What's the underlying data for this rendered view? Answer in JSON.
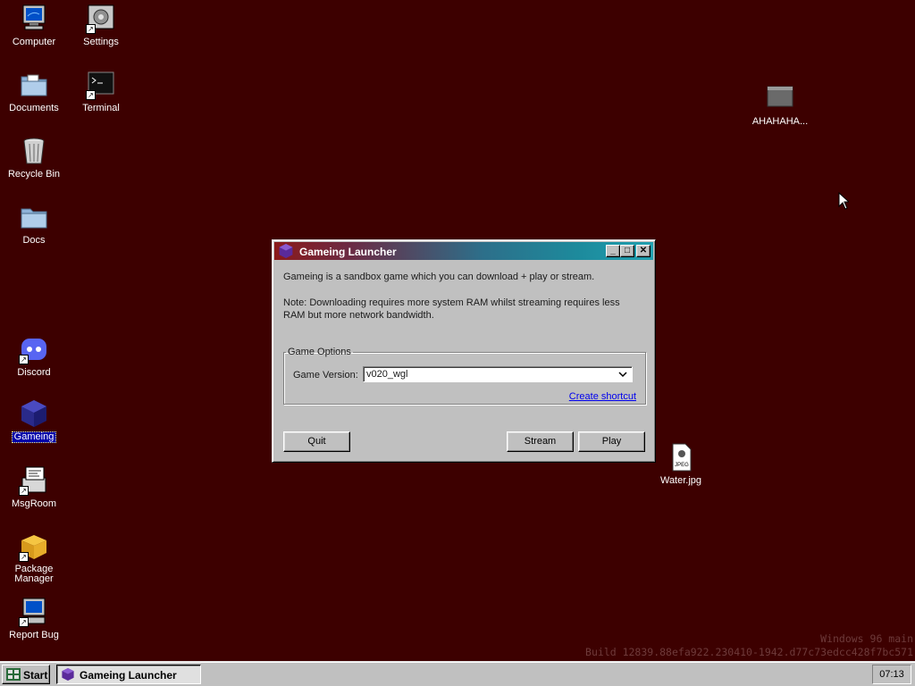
{
  "desktop": {
    "background": "#3d0000",
    "icons": {
      "computer": {
        "label": "Computer",
        "icon": "computer-icon"
      },
      "settings": {
        "label": "Settings",
        "icon": "settings-icon"
      },
      "documents": {
        "label": "Documents",
        "icon": "documents-folder-icon"
      },
      "terminal": {
        "label": "Terminal",
        "icon": "terminal-icon"
      },
      "recycle_bin": {
        "label": "Recycle Bin",
        "icon": "recycle-bin-icon"
      },
      "docs": {
        "label": "Docs",
        "icon": "folder-icon"
      },
      "discord": {
        "label": "Discord",
        "icon": "discord-icon"
      },
      "gameing": {
        "label": "Gameing",
        "icon": "gameing-cube-icon",
        "selected": true
      },
      "msgroom": {
        "label": "MsgRoom",
        "icon": "msgroom-icon"
      },
      "package_manager": {
        "label": "Package Manager",
        "icon": "package-icon"
      },
      "report_bug": {
        "label": "Report Bug",
        "icon": "report-bug-icon"
      },
      "ahahaha": {
        "label": "AHAHAHA...",
        "icon": "dark-folder-icon"
      },
      "water": {
        "label": "Water.jpg",
        "icon": "jpeg-file-icon"
      }
    },
    "watermark": {
      "line1": "Windows 96 main",
      "line2": "Build 12839.88efa922.230410-1942.d77c73edcc428f7bc571"
    }
  },
  "window": {
    "title": "Gameing Launcher",
    "controls": {
      "minimize": "_",
      "maximize": "□",
      "close": "✕"
    },
    "description": "Gameing is a sandbox game which you can download + play or stream.",
    "note": "Note: Downloading requires more system RAM whilst streaming requires less RAM but more network bandwidth.",
    "group_title": "Game Options",
    "version_label": "Game Version:",
    "version_value": "v020_wgl",
    "shortcut_link": "Create shortcut",
    "buttons": {
      "quit": "Quit",
      "stream": "Stream",
      "play": "Play"
    }
  },
  "taskbar": {
    "start_label": "Start",
    "task_label": "Gameing Launcher",
    "clock": "07:13"
  }
}
